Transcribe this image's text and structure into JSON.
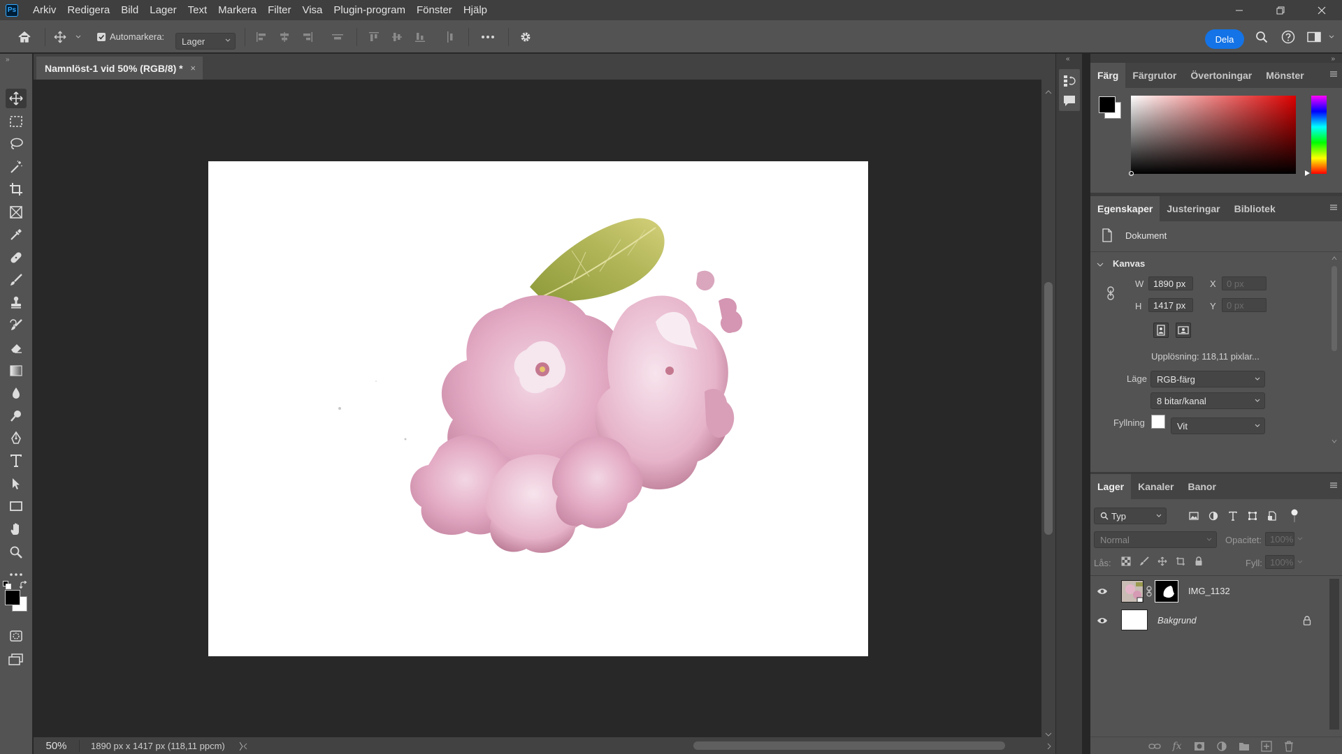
{
  "menu": {
    "items": [
      "Arkiv",
      "Redigera",
      "Bild",
      "Lager",
      "Text",
      "Markera",
      "Filter",
      "Visa",
      "Plugin-program",
      "Fönster",
      "Hjälp"
    ]
  },
  "options": {
    "automarkera_label": "Automarkera:",
    "automarkera_checked": true,
    "target_value": "Lager",
    "share_label": "Dela"
  },
  "document": {
    "tab_title": "Namnlöst-1 vid 50% (RGB/8) *",
    "tab_close": "×"
  },
  "status": {
    "zoom": "50%",
    "doc_size": "1890 px x 1417 px (118,11 ppcm)",
    "arrow": "〉"
  },
  "color_panel": {
    "tabs": [
      "Färg",
      "Färgrutor",
      "Övertoningar",
      "Mönster"
    ],
    "active_tab": 0,
    "foreground": "#000000",
    "background": "#ffffff",
    "hue_color": "#dd0000"
  },
  "properties_panel": {
    "tabs": [
      "Egenskaper",
      "Justeringar",
      "Bibliotek"
    ],
    "active_tab": 0,
    "doc_label": "Dokument",
    "section_title": "Kanvas",
    "width_label": "W",
    "width_value": "1890 px",
    "height_label": "H",
    "height_value": "1417 px",
    "x_label": "X",
    "x_placeholder": "0 px",
    "y_label": "Y",
    "y_placeholder": "0 px",
    "resolution": "Upplösning: 118,11 pixlar...",
    "mode_label": "Läge",
    "mode_value": "RGB-färg",
    "bits_value": "8 bitar/kanal",
    "fill_label": "Fyllning",
    "fill_value": "Vit"
  },
  "layers_panel": {
    "tabs": [
      "Lager",
      "Kanaler",
      "Banor"
    ],
    "active_tab": 0,
    "filter_kind": "Typ",
    "blend_mode": "Normal",
    "opacity_label": "Opacitet:",
    "opacity_value": "100%",
    "lock_label": "Lås:",
    "fill_label": "Fyll:",
    "fill_value": "100%",
    "layers": [
      {
        "name": "IMG_1132",
        "visible": true,
        "has_mask": true,
        "locked": false
      },
      {
        "name": "Bakgrund",
        "visible": true,
        "has_mask": false,
        "locked": true
      }
    ]
  },
  "colors": {
    "accent": "#1473e6",
    "panel": "#535353",
    "canvas": "#282828"
  }
}
